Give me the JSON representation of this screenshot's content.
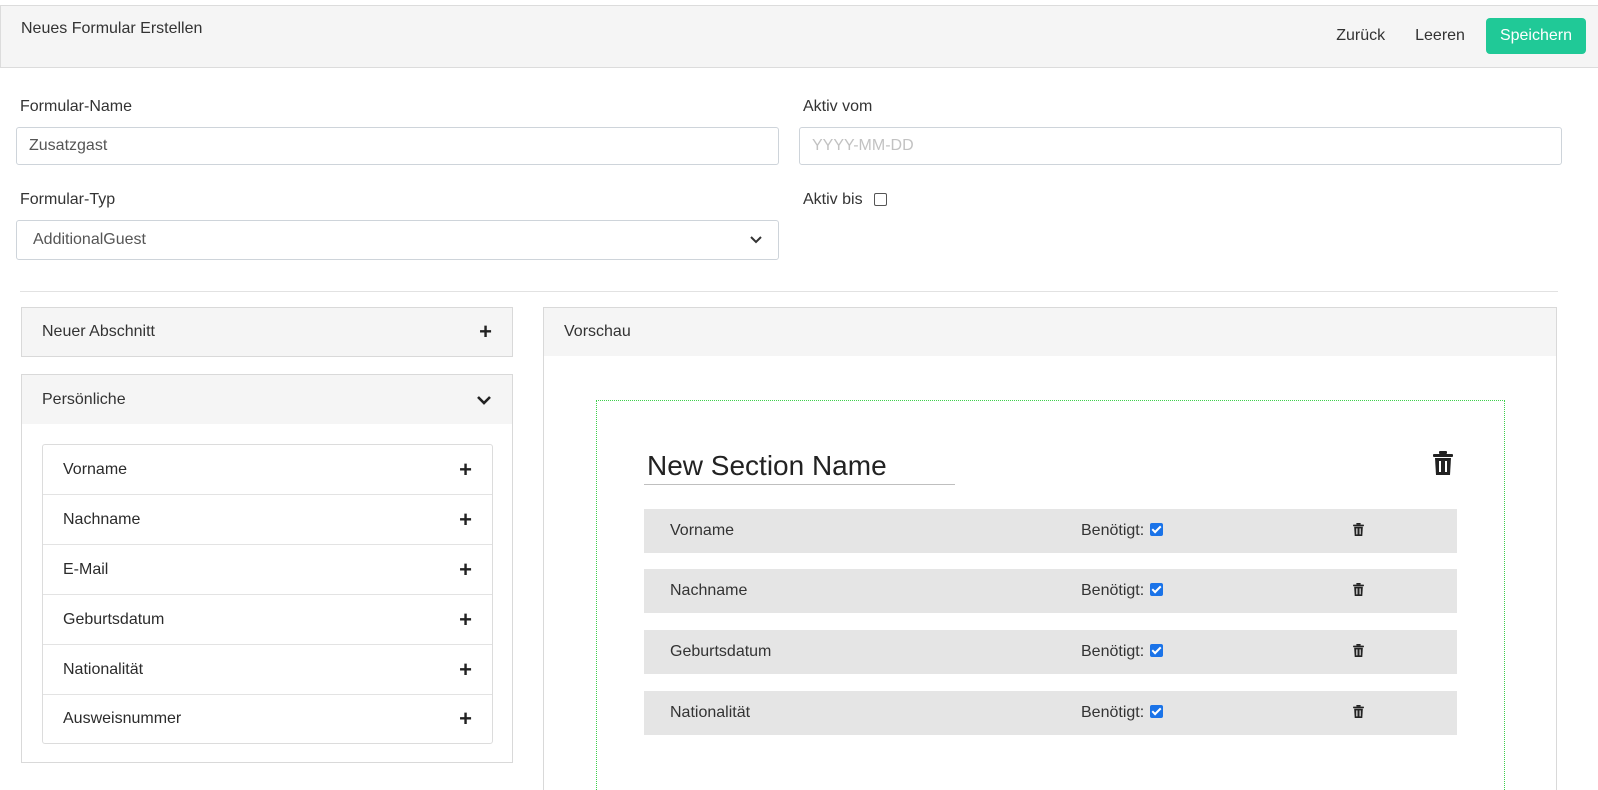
{
  "header": {
    "title": "Neues Formular Erstellen",
    "back_label": "Zurück",
    "clear_label": "Leeren",
    "save_label": "Speichern"
  },
  "form": {
    "name_label": "Formular-Name",
    "name_value": "Zusatzgast",
    "active_from_label": "Aktiv vom",
    "active_from_placeholder": "YYYY-MM-DD",
    "type_label": "Formular-Typ",
    "type_value": "AdditionalGuest",
    "active_until_label": "Aktiv bis"
  },
  "sidebar": {
    "new_section_label": "Neuer Abschnitt",
    "group_label": "Persönliche",
    "items": [
      {
        "label": "Vorname"
      },
      {
        "label": "Nachname"
      },
      {
        "label": "E-Mail"
      },
      {
        "label": "Geburtsdatum"
      },
      {
        "label": "Nationalität"
      },
      {
        "label": "Ausweisnummer"
      }
    ]
  },
  "preview": {
    "title": "Vorschau",
    "section_name": "New Section Name",
    "required_label": "Benötigt:",
    "rows": [
      {
        "label": "Vorname",
        "required": true
      },
      {
        "label": "Nachname",
        "required": true
      },
      {
        "label": "Geburtsdatum",
        "required": true
      },
      {
        "label": "Nationalität",
        "required": true
      }
    ]
  }
}
